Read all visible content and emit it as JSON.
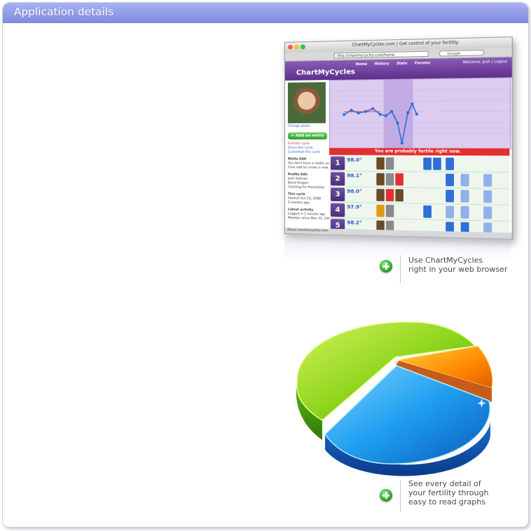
{
  "header": {
    "title": "Application details"
  },
  "screenshot": {
    "window_title": "ChartMyCycles.com | Get control of your fertility",
    "url": "http://chartmycycles.com/home",
    "search_placeholder": "Google",
    "brand": "ChartMyCycles",
    "nav": [
      "Home",
      "History",
      "Stats",
      "Forums"
    ],
    "welcome": "Welcome, Josh | Logout",
    "add_entry": "+ Add an entry",
    "fertile_banner": "You are probably fertile right now.",
    "sidebar_links": [
      "Change photo",
      "End this cycle",
      "Share this cycle",
      "Customize this cycle"
    ],
    "sidebar_text": [
      "Motto Edit",
      "You don't have a motto yet.",
      "Click edit to create a new one.",
      "Profile Edit",
      "Josh Sullivan",
      "Bend Oregon",
      "Charting for Prevention",
      "This cycle",
      "Started Oct 15, 2008",
      "2 months ago",
      "Latest activity",
      "Logged in 1 minute ago",
      "Member since Nov 15, 2008"
    ],
    "days": [
      {
        "day": "1",
        "temp": "98.0°"
      },
      {
        "day": "2",
        "temp": "98.1°"
      },
      {
        "day": "3",
        "temp": "98.0°"
      },
      {
        "day": "4",
        "temp": "97.9°"
      },
      {
        "day": "5",
        "temp": "98.2°"
      }
    ],
    "status": "About chartmycycles.com"
  },
  "features": [
    {
      "caption_line1": "Use ChartMyCycles",
      "caption_line2": "right in your web browser",
      "caption_line3": ""
    },
    {
      "caption_line1": "See every detail of",
      "caption_line2": "your fertility through",
      "caption_line3": "easy to read graphs"
    }
  ],
  "colors": {
    "header_top": "#a9b2ef",
    "header_bottom": "#7f8ae0",
    "pie_green": "#8fd61e",
    "pie_blue": "#1f8fe0",
    "pie_orange": "#ff8a00",
    "plus_green": "#2fa52a"
  }
}
